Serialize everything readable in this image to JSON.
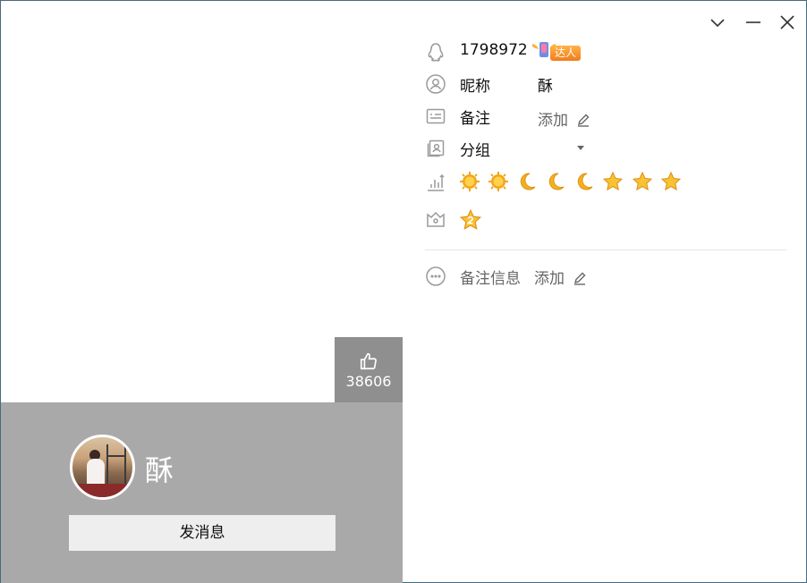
{
  "window": {
    "controls": [
      "chevron-down-icon",
      "minimize-icon",
      "close-icon"
    ]
  },
  "profile": {
    "nickname_display": "酥",
    "likes": "38606",
    "send_message_label": "发消息"
  },
  "info": {
    "qq_number": "1798972",
    "badge_text": "达人",
    "nickname_label": "昵称",
    "nickname_value": "酥",
    "remark_label": "备注",
    "remark_action": "添加",
    "group_label": "分组",
    "group_value": "",
    "level_icons": [
      "sun-icon",
      "sun-icon",
      "moon-icon",
      "moon-icon",
      "moon-icon",
      "star-icon",
      "star-icon",
      "star-icon"
    ],
    "vip_icon": "vip-2-star-icon",
    "remark_info_label": "备注信息",
    "remark_info_action": "添加"
  },
  "colors": {
    "panel_gray": "#a9a9a9",
    "like_box": "#8f8f8f",
    "button_bg": "#eeeeee",
    "accent_orange": "#f07c1c"
  }
}
